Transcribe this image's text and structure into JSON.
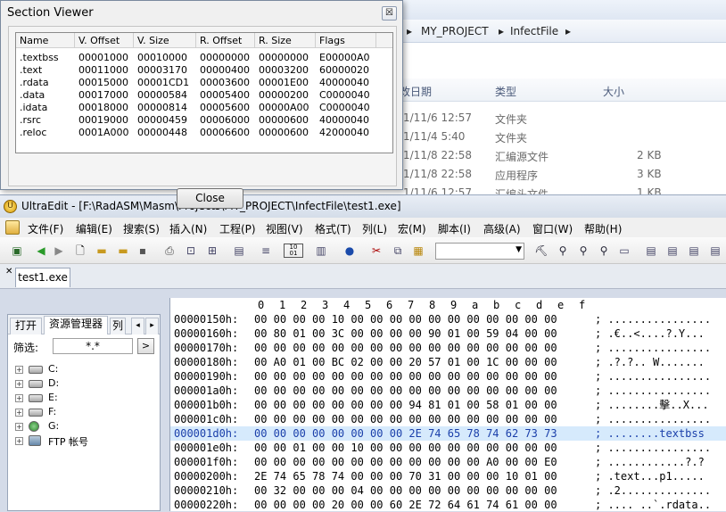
{
  "explorer": {
    "breadcrumb": [
      "MY_PROJECT",
      "InfectFile"
    ],
    "headers": [
      "改日期",
      "类型",
      "大小"
    ],
    "rows": [
      {
        "date": "1/11/6 12:57",
        "type": "文件夹",
        "size": ""
      },
      {
        "date": "1/11/4 5:40",
        "type": "文件夹",
        "size": ""
      },
      {
        "date": "1/11/8 22:58",
        "type": "汇编源文件",
        "size": "2 KB"
      },
      {
        "date": "1/11/8 22:58",
        "type": "应用程序",
        "size": "3 KB"
      },
      {
        "date": "1/11/6 12:57",
        "type": "汇编头文件",
        "size": "1 KB"
      }
    ]
  },
  "dialog": {
    "title": "Section Viewer",
    "close_glyph": "☒",
    "close_button": "Close",
    "columns": [
      "Name",
      "V. Offset",
      "V. Size",
      "R. Offset",
      "R. Size",
      "Flags"
    ],
    "sections": [
      [
        ".textbss",
        "00001000",
        "00010000",
        "00000000",
        "00000000",
        "E00000A0"
      ],
      [
        ".text",
        "00011000",
        "00003170",
        "00000400",
        "00003200",
        "60000020"
      ],
      [
        ".rdata",
        "00015000",
        "00001CD1",
        "00003600",
        "00001E00",
        "40000040"
      ],
      [
        ".data",
        "00017000",
        "00000584",
        "00005400",
        "00000200",
        "C0000040"
      ],
      [
        ".idata",
        "00018000",
        "00000814",
        "00005600",
        "00000A00",
        "C0000040"
      ],
      [
        ".rsrc",
        "00019000",
        "00000459",
        "00006000",
        "00000600",
        "40000040"
      ],
      [
        ".reloc",
        "0001A000",
        "00000448",
        "00006600",
        "00000600",
        "42000040"
      ]
    ]
  },
  "ultraedit": {
    "title": "UltraEdit - [F:\\RadASM\\Masm\\Projects\\MY_PROJECT\\InfectFile\\test1.exe]",
    "menus": [
      "文件(F)",
      "编辑(E)",
      "搜索(S)",
      "插入(N)",
      "工程(P)",
      "视图(V)",
      "格式(T)",
      "列(L)",
      "宏(M)",
      "脚本(I)",
      "高级(A)",
      "窗口(W)",
      "帮助(H)"
    ],
    "tab": "test1.exe",
    "panel": {
      "tabs": [
        "打开",
        "资源管理器",
        "列"
      ],
      "filter_label": "筛选:",
      "filter_value": "*.*",
      "filter_button": ">",
      "drives": [
        "C:",
        "D:",
        "E:",
        "F:",
        "G:",
        "FTP 帐号"
      ]
    },
    "hex": {
      "ruler": [
        "0",
        "1",
        "2",
        "3",
        "4",
        "5",
        "6",
        "7",
        "8",
        "9",
        "a",
        "b",
        "c",
        "d",
        "e",
        "f"
      ],
      "rows": [
        {
          "addr": "00000150h:",
          "bytes": "00 00 00 00 10 00 00 00 00 00 00 00 00 00 00 00",
          "ascii": "; ................"
        },
        {
          "addr": "00000160h:",
          "bytes": "00 80 01 00 3C 00 00 00 00 90 01 00 59 04 00 00",
          "ascii": "; .€..<....?.Y..."
        },
        {
          "addr": "00000170h:",
          "bytes": "00 00 00 00 00 00 00 00 00 00 00 00 00 00 00 00",
          "ascii": "; ................"
        },
        {
          "addr": "00000180h:",
          "bytes": "00 A0 01 00 BC 02 00 00 20 57 01 00 1C 00 00 00",
          "ascii": "; .?.?.. W......."
        },
        {
          "addr": "00000190h:",
          "bytes": "00 00 00 00 00 00 00 00 00 00 00 00 00 00 00 00",
          "ascii": "; ................"
        },
        {
          "addr": "000001a0h:",
          "bytes": "00 00 00 00 00 00 00 00 00 00 00 00 00 00 00 00",
          "ascii": "; ................"
        },
        {
          "addr": "000001b0h:",
          "bytes": "00 00 00 00 00 00 00 00 94 81 01 00 58 01 00 00",
          "ascii": "; ........擊..X..."
        },
        {
          "addr": "000001c0h:",
          "bytes": "00 00 00 00 00 00 00 00 00 00 00 00 00 00 00 00",
          "ascii": "; ................"
        },
        {
          "addr": "000001d0h:",
          "bytes": "00 00 00 00 00 00 00 00 2E 74 65 78 74 62 73 73",
          "ascii": "; ........textbss"
        },
        {
          "addr": "000001e0h:",
          "bytes": "00 00 01 00 00 10 00 00 00 00 00 00 00 00 00 00",
          "ascii": "; ................"
        },
        {
          "addr": "000001f0h:",
          "bytes": "00 00 00 00 00 00 00 00 00 00 00 00 A0 00 00 E0",
          "ascii": "; ............?.?"
        },
        {
          "addr": "00000200h:",
          "bytes": "2E 74 65 78 74 00 00 00 70 31 00 00 00 10 01 00",
          "ascii": "; .text...p1....."
        },
        {
          "addr": "00000210h:",
          "bytes": "00 32 00 00 00 04 00 00 00 00 00 00 00 00 00 00",
          "ascii": "; .2.............."
        },
        {
          "addr": "00000220h:",
          "bytes": "00 00 00 00 20 00 00 60 2E 72 64 61 74 61 00 00",
          "ascii": "; .... ..`.rdata.."
        }
      ],
      "selected_row": 8
    }
  }
}
